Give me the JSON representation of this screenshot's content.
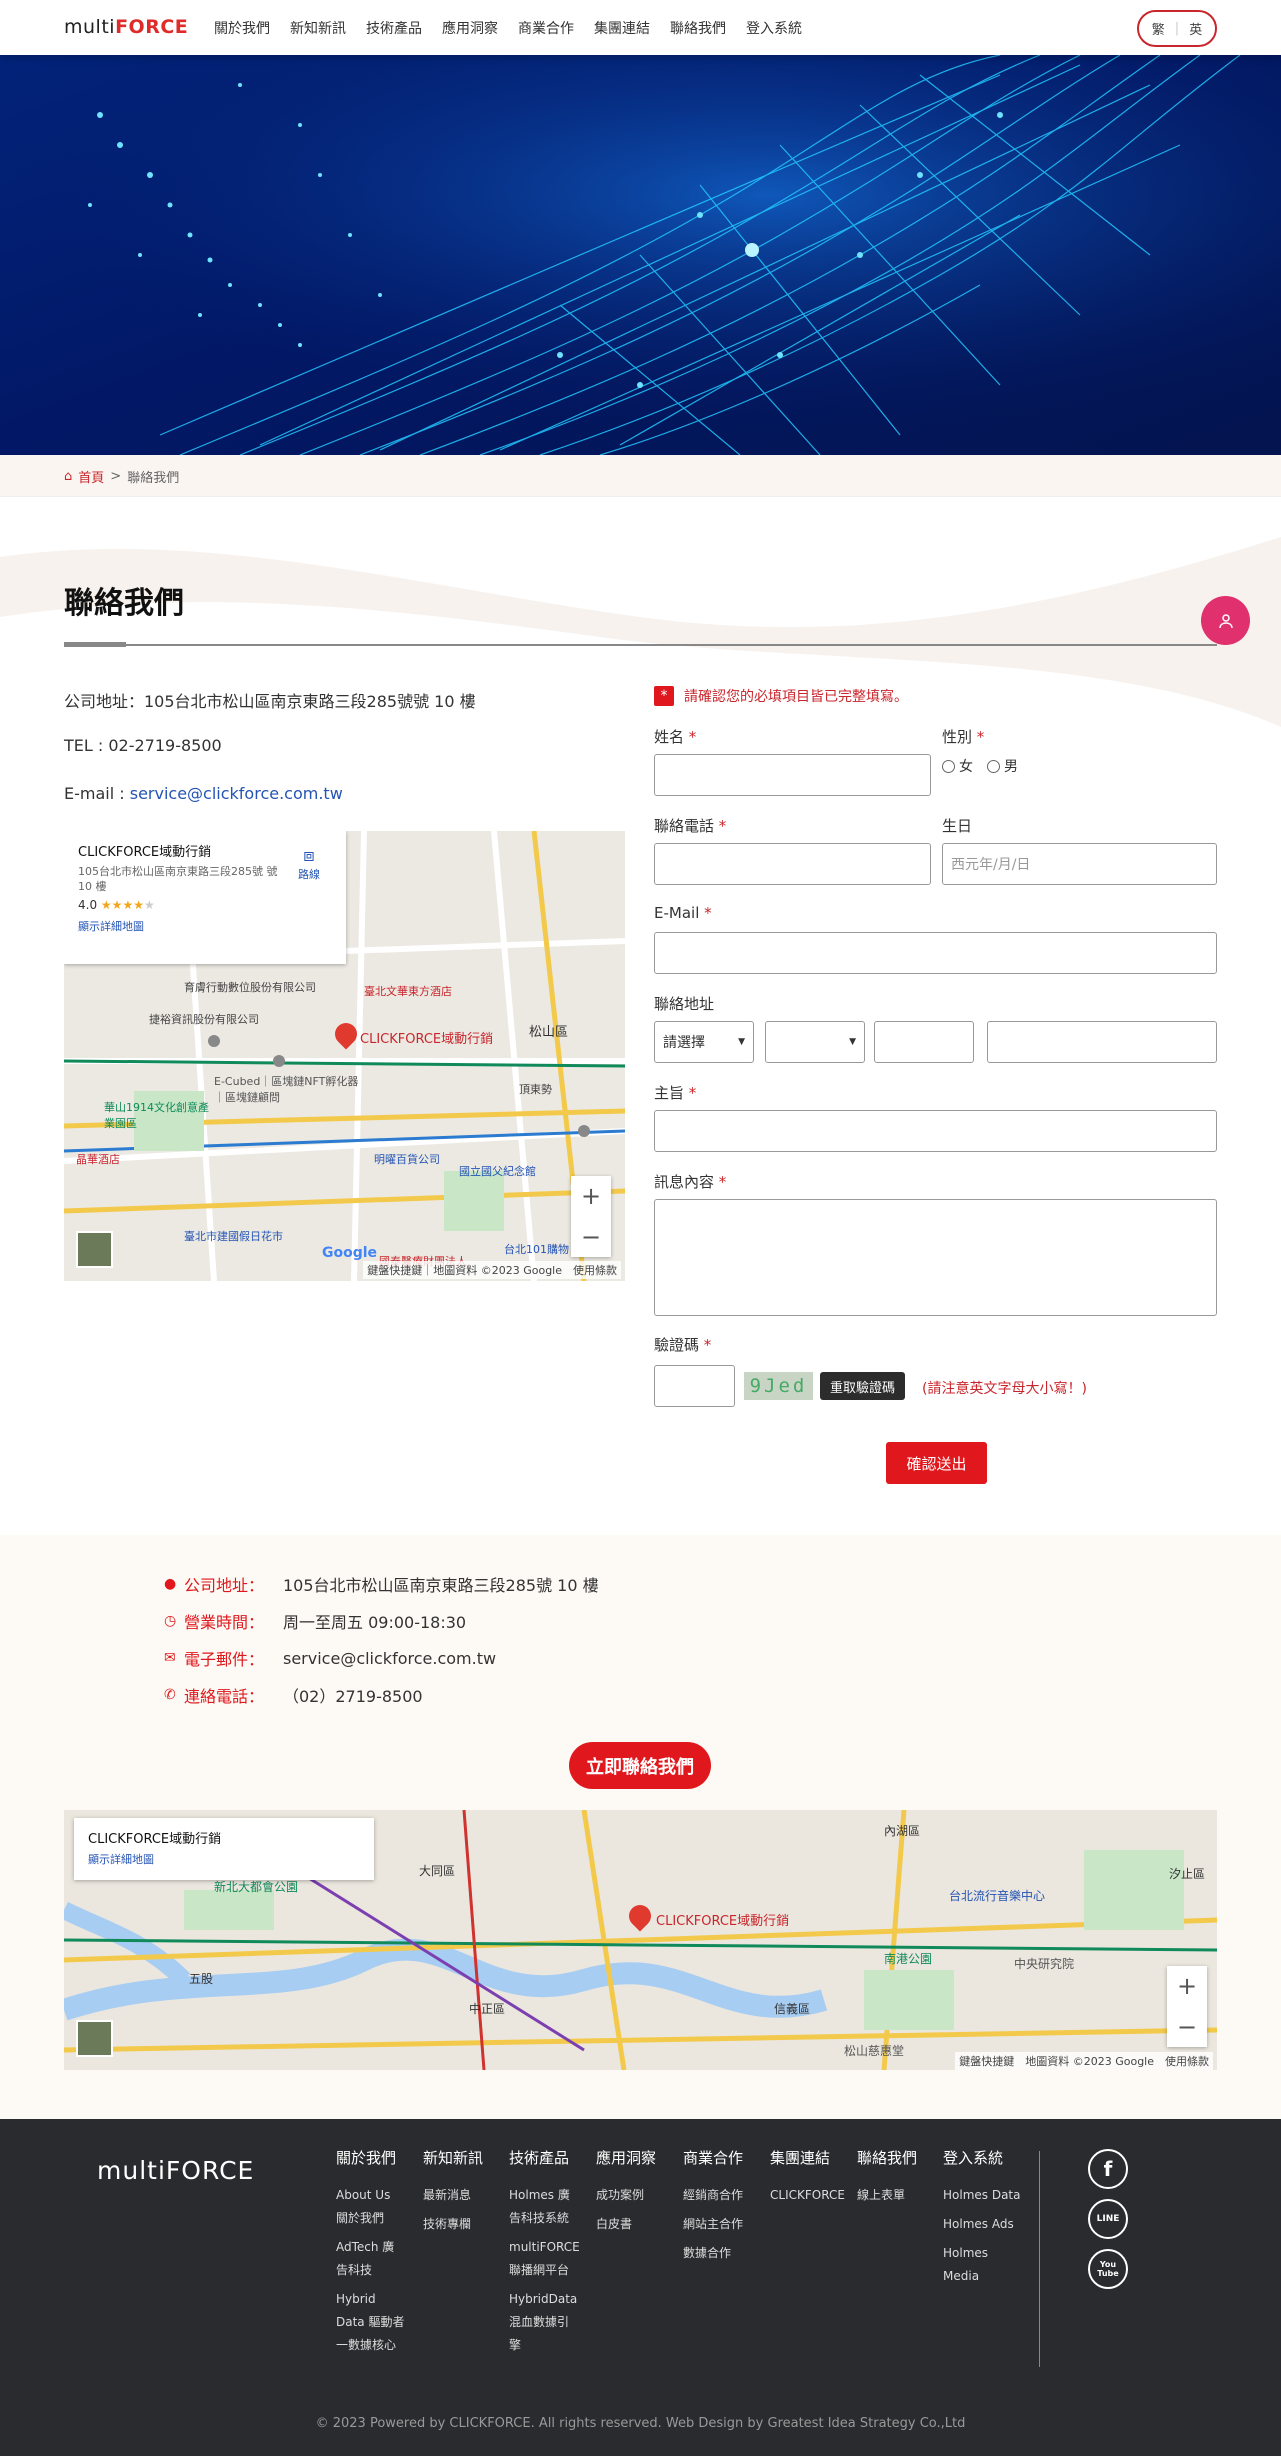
{
  "header": {
    "logo_prefix": "multi",
    "logo_brand": "FORCE",
    "nav": [
      "關於我們",
      "新知新訊",
      "技術產品",
      "應用洞察",
      "商業合作",
      "集團連結",
      "聯絡我們",
      "登入系統"
    ],
    "lang_tc": "繁",
    "lang_sep": "|",
    "lang_en": "英"
  },
  "breadcrumb": {
    "home": "首頁",
    "sep": ">",
    "current": "聯絡我們"
  },
  "page": {
    "title": "聯絡我們"
  },
  "info": {
    "address": "公司地址：105台北市松山區南京東路三段285號號 10 樓",
    "tel": "TEL : 02-2719-8500",
    "email_label": "E-mail : ",
    "email": "service@clickforce.com.tw"
  },
  "map1": {
    "name": "CLICKFORCE域動行銷",
    "address": "105台北市松山區南京東路三段285號 號 10 樓",
    "rating": "4.0",
    "stars": "★★★★",
    "star_empty": "★",
    "route": "路線",
    "more": "顯示詳細地圖",
    "pin_label": "CLICKFORCE域動行銷",
    "zoom_in": "+",
    "zoom_out": "−",
    "google": "Google",
    "attr": "鍵盤快捷鍵｜地圖資料 ©2023 Google　使用條款",
    "labels": [
      "晶華酒店",
      "育膚行動數位股份有限公司",
      "捷裕資訊股份有限公司",
      "臺北文華東方酒店",
      "松山區",
      "頂東勢",
      "E-Cubed｜區塊鏈NFT孵化器｜區塊鏈顧問",
      "華山1914文化創意產業園區",
      "明曜百貨公司",
      "國立國父紀念館",
      "臺北市建國假日花市",
      "國泰醫療財團法人",
      "台北101購物"
    ]
  },
  "form": {
    "notice_mark": "*",
    "notice": "請確認您的必填項目皆已完整填寫。",
    "req": "*",
    "name_label": "姓名",
    "gender_label": "性別",
    "female": "女",
    "male": "男",
    "phone_label": "聯絡電話",
    "birthday_label": "生日",
    "birthday_placeholder": "西元年/月/日",
    "email_label": "E-Mail",
    "addr_label": "聯絡地址",
    "addr_select": "請選擇",
    "subject_label": "主旨",
    "message_label": "訊息內容",
    "captcha_label": "驗證碼",
    "captcha_text": "9Jed",
    "captcha_btn": "重取驗證碼",
    "captcha_note": "(請注意英文字母大小寫！)",
    "submit": "確認送出"
  },
  "contact": {
    "addr_label": "公司地址：",
    "addr": "105台北市松山區南京東路三段285號 10 樓",
    "hours_label": "營業時間：",
    "hours": "周一至周五 09:00-18:30",
    "email_label": "電子郵件：",
    "email": "service@clickforce.com.tw",
    "phone_label": "連絡電話：",
    "phone": "（02）2719-8500",
    "cta": "立即聯絡我們"
  },
  "map2": {
    "name": "CLICKFORCE域動行銷",
    "more": "顯示詳細地圖",
    "pin_label": "CLICKFORCE域動行銷",
    "attr": "鍵盤快捷鍵　地圖資料 ©2023 Google　使用條款",
    "labels": [
      "大同區",
      "中正區",
      "信義區",
      "內湖區",
      "汐止區",
      "南港公園",
      "中央研究院",
      "新北大都會公園",
      "五股",
      "台北流行音樂中心",
      "松山慈惠堂"
    ]
  },
  "footer": {
    "logo": "multiFORCE",
    "columns": [
      {
        "h": "關於我們",
        "items": [
          "About Us 關於我們",
          "AdTech 廣告科技",
          "Hybrid Data 驅動者一數據核心"
        ]
      },
      {
        "h": "新知新訊",
        "items": [
          "最新消息",
          "技術專欄"
        ]
      },
      {
        "h": "技術產品",
        "items": [
          "Holmes 廣告科技系統",
          "multiFORCE 聯播網平台",
          "HybridData 混血數據引擎"
        ]
      },
      {
        "h": "應用洞察",
        "items": [
          "成功案例",
          "白皮書"
        ]
      },
      {
        "h": "商業合作",
        "items": [
          "經銷商合作",
          "網站主合作",
          "數據合作"
        ]
      },
      {
        "h": "集團連結",
        "items": [
          "CLICKFORCE"
        ]
      },
      {
        "h": "聯絡我們",
        "items": [
          "線上表單"
        ]
      },
      {
        "h": "登入系統",
        "items": [
          "Holmes Data",
          "Holmes Ads",
          "Holmes Media"
        ]
      }
    ],
    "social": [
      "f",
      "LINE",
      "You Tube"
    ],
    "copyright": "© 2023 Powered by CLICKFORCE. All rights reserved. Web Design by Greatest Idea Strategy Co.,Ltd"
  }
}
